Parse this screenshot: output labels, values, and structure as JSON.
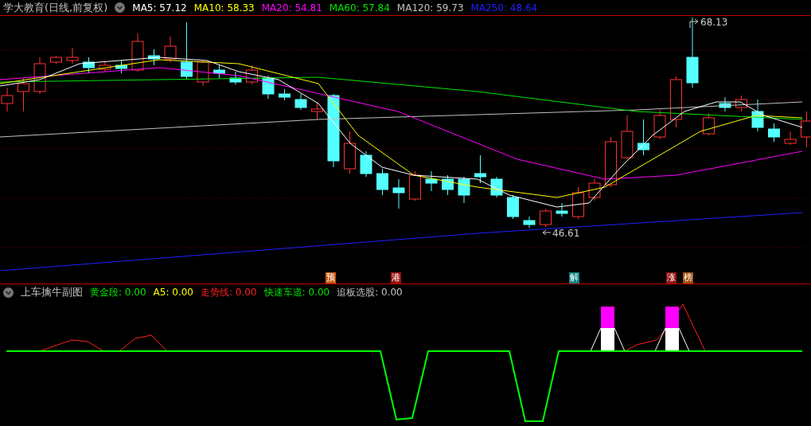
{
  "header": {
    "title": "学大教育(日线,前复权)",
    "indicators": [
      {
        "label": "MA5:",
        "value": "57.12",
        "color": "#ffffff"
      },
      {
        "label": "MA10:",
        "value": "58.33",
        "color": "#ffff00"
      },
      {
        "label": "MA20:",
        "value": "54.81",
        "color": "#ff00ff"
      },
      {
        "label": "MA60:",
        "value": "57.84",
        "color": "#00e600"
      },
      {
        "label": "MA120:",
        "value": "59.73",
        "color": "#c0c0c0"
      },
      {
        "label": "MA250:",
        "value": "48.64",
        "color": "#2020ff"
      }
    ]
  },
  "price_chart": {
    "high_label": "68.13",
    "low_label": "46.61"
  },
  "event_markers": [
    {
      "text": "预",
      "color": "#c85a14"
    },
    {
      "text": "港",
      "color": "#a01010"
    },
    {
      "text": "解",
      "color": "#108080"
    },
    {
      "text": "涨",
      "color": "#901010"
    },
    {
      "text": "榜",
      "color": "#a05010"
    }
  ],
  "sub_chart": {
    "title": "上车擒牛副图",
    "indicators": [
      {
        "label": "黄金段:",
        "value": "0.00",
        "color": "#00e600"
      },
      {
        "label": "A5:",
        "value": "0.00",
        "color": "#ffff00"
      },
      {
        "label": "走势线:",
        "value": "0.00",
        "color": "#ff2020"
      },
      {
        "label": "快速车道:",
        "value": "0.00",
        "color": "#00e600"
      },
      {
        "label": "追板选股:",
        "value": "0.00",
        "color": "#c0c0c0"
      }
    ]
  }
}
